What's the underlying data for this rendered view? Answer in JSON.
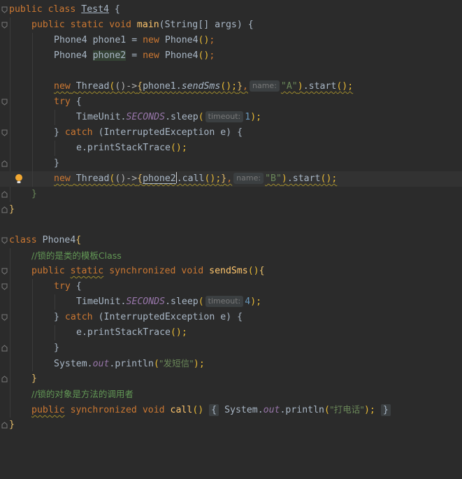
{
  "editor": {
    "colors": {
      "background": "#2b2b2b",
      "keyword": "#cc7832",
      "function": "#ffc66d",
      "string": "#6a8759",
      "number": "#6897bb",
      "static_field": "#9876aa",
      "comment": "#629755",
      "hint_bg": "#3b3f41"
    },
    "l1": {
      "kw1": "public",
      "kw2": "class",
      "name": "Test4",
      "brace": "{"
    },
    "l2": {
      "kw1": "public",
      "kw2": "static",
      "kw3": "void",
      "fn": "main",
      "params": "(String[] args)",
      "brace": "{"
    },
    "l3": {
      "type": "Phone4",
      "var": "phone1",
      "eq": "=",
      "kw": "new",
      "ctor": "Phone4",
      "args": "()",
      "semi": ";"
    },
    "l4": {
      "type": "Phone4",
      "var": "phone2",
      "eq": "=",
      "kw": "new",
      "ctor": "Phone4",
      "args": "()",
      "semi": ";"
    },
    "l6": {
      "kw": "new",
      "thread": "Thread",
      "open": "(",
      "lam": "()->",
      "lb": "{",
      "target": "phone1",
      "dot": ".",
      "method": "sendSms",
      "call": "();",
      "rb": "}",
      "comma": ",",
      "hint": "name:",
      "arg": "\"A\"",
      "close": ")",
      "start": ".start",
      "end": "();"
    },
    "l7": {
      "kw": "try",
      "brace": "{"
    },
    "l8": {
      "cls": "TimeUnit",
      "dot": ".",
      "field": "SECONDS",
      "sleep": ".sleep",
      "open": "(",
      "hint": "timeout:",
      "num": "1",
      "close": ");"
    },
    "l9": {
      "rb": "}",
      "kw": "catch",
      "sig": "(InterruptedException e)",
      "lb": "{"
    },
    "l10": {
      "call": "e.printStackTrace",
      "parens": "();"
    },
    "l11": {
      "rb": "}"
    },
    "l12": {
      "kw": "new",
      "thread": "Thread",
      "open": "(",
      "lam": "()->",
      "lb": "{",
      "target": "phone2",
      "rest": ".call",
      "call": "();",
      "rb": "}",
      "comma": ",",
      "hint": "name:",
      "arg": "\"B\"",
      "close": ")",
      "start": ".start",
      "end": "();"
    },
    "l13": {
      "rb": "}"
    },
    "l14": {
      "rb": "}"
    },
    "l16": {
      "kw": "class",
      "name": "Phone4",
      "lb": "{"
    },
    "l17": {
      "cmt": "//锁的是类的模板Class"
    },
    "l18": {
      "kw1": "public",
      "kw2": "static",
      "kw3": "synchronized",
      "kw4": "void",
      "fn": "sendSms",
      "paren": "()",
      "lb": "{"
    },
    "l19": {
      "kw": "try",
      "brace": "{"
    },
    "l20": {
      "cls": "TimeUnit",
      "dot": ".",
      "field": "SECONDS",
      "sleep": ".sleep",
      "open": "(",
      "hint": "timeout:",
      "num": "4",
      "close": ");"
    },
    "l21": {
      "rb": "}",
      "kw": "catch",
      "sig": "(InterruptedException e)",
      "lb": "{"
    },
    "l22": {
      "call": "e.printStackTrace",
      "parens": "();"
    },
    "l23": {
      "rb": "}"
    },
    "l24": {
      "cls": "System",
      "dot": ".",
      "field": "out",
      "println": ".println",
      "open": "(",
      "str": "\"发短信\"",
      "close": ");"
    },
    "l25": {
      "rb": "}"
    },
    "l26": {
      "cmt": "//锁的对象是方法的调用者"
    },
    "l27": {
      "kw1": "public",
      "kw2": "synchronized",
      "kw3": "void",
      "fn": "call",
      "paren": "()",
      "lb": "{",
      "cls": "System",
      "dot": ".",
      "field": "out",
      "println": ".println",
      "open": "(",
      "str": "\"打电话\"",
      "close": ");",
      "rb": "}"
    },
    "l28": {
      "rb": "}"
    }
  }
}
